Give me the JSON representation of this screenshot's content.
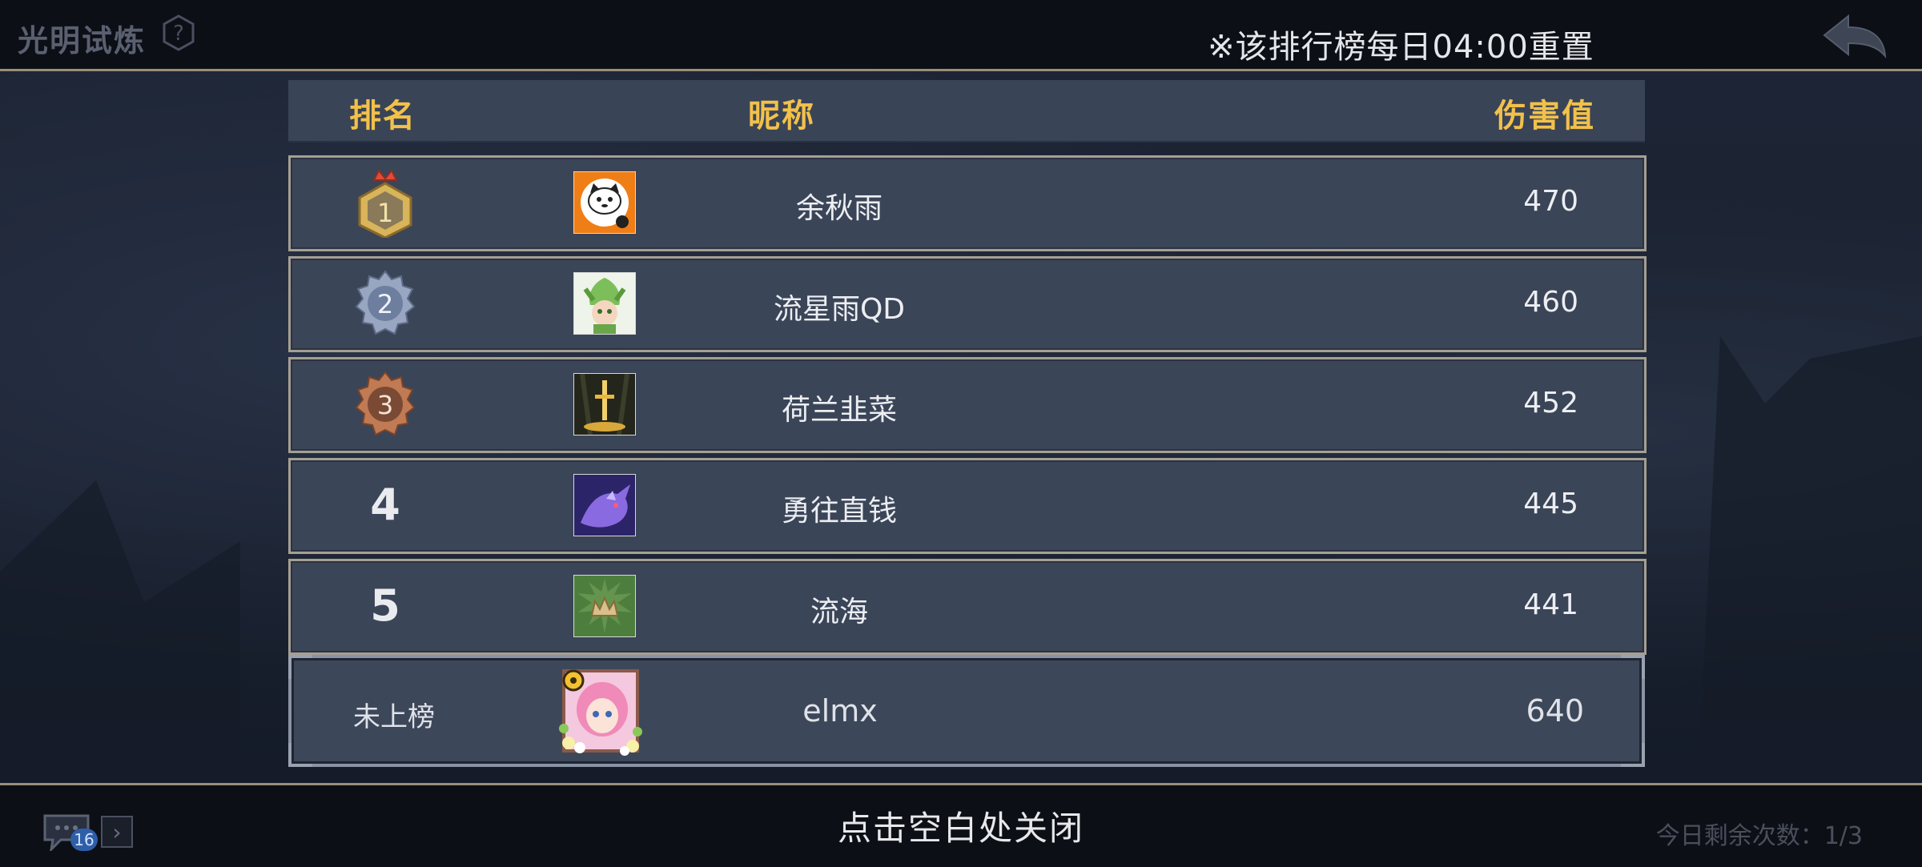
{
  "header": {
    "title": "光明试炼",
    "reset_note": "※该排行榜每日04:00重置"
  },
  "board": {
    "columns": {
      "rank": "排名",
      "name": "昵称",
      "damage": "伤害值"
    },
    "rows": [
      {
        "rank": "1",
        "name": "余秋雨",
        "damage": "470",
        "medal": "gold",
        "avatar_icon": "cat-avatar-icon"
      },
      {
        "rank": "2",
        "name": "流星雨QD",
        "damage": "460",
        "medal": "silver",
        "avatar_icon": "green-elf-avatar-icon"
      },
      {
        "rank": "3",
        "name": "荷兰韭菜",
        "damage": "452",
        "medal": "bronze",
        "avatar_icon": "golden-sword-avatar-icon"
      },
      {
        "rank": "4",
        "name": "勇往直钱",
        "damage": "445",
        "medal": "",
        "avatar_icon": "purple-dragon-avatar-icon"
      },
      {
        "rank": "5",
        "name": "流海",
        "damage": "441",
        "medal": "",
        "avatar_icon": "green-crown-avatar-icon"
      }
    ],
    "self": {
      "rank": "未上榜",
      "name": "elmx",
      "damage": "640",
      "avatar_icon": "pink-hair-girl-avatar-icon"
    }
  },
  "footer": {
    "close_hint": "点击空白处关闭",
    "chat_count": "16",
    "attempts": "今日剩余次数：1/3"
  },
  "colors": {
    "header_text": "#f2c14a",
    "row_bg": "#3b4558",
    "row_border": "#a59f93",
    "gold_medal": "#c9a24a",
    "silver_medal": "#8e9cb8",
    "bronze_medal": "#b06a48"
  }
}
